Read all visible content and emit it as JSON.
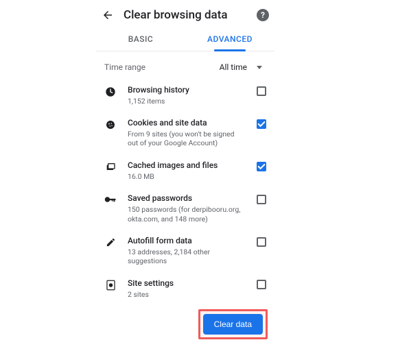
{
  "header": {
    "title": "Clear browsing data"
  },
  "tabs": {
    "basic": "BASIC",
    "advanced": "ADVANCED"
  },
  "timeRange": {
    "label": "Time range",
    "value": "All time"
  },
  "items": [
    {
      "title": "Browsing history",
      "subtitle": "1,152 items",
      "checked": false
    },
    {
      "title": "Cookies and site data",
      "subtitle": "From 9 sites (you won't be signed out of your Google Account)",
      "checked": true
    },
    {
      "title": "Cached images and files",
      "subtitle": "16.0 MB",
      "checked": true
    },
    {
      "title": "Saved passwords",
      "subtitle": "150 passwords (for derpibooru.org, okta.com, and 148 more)",
      "checked": false
    },
    {
      "title": "Autofill form data",
      "subtitle": "13 addresses, 2,184 other suggestions",
      "checked": false
    },
    {
      "title": "Site settings",
      "subtitle": "2 sites",
      "checked": false
    }
  ],
  "actions": {
    "clearData": "Clear data"
  }
}
